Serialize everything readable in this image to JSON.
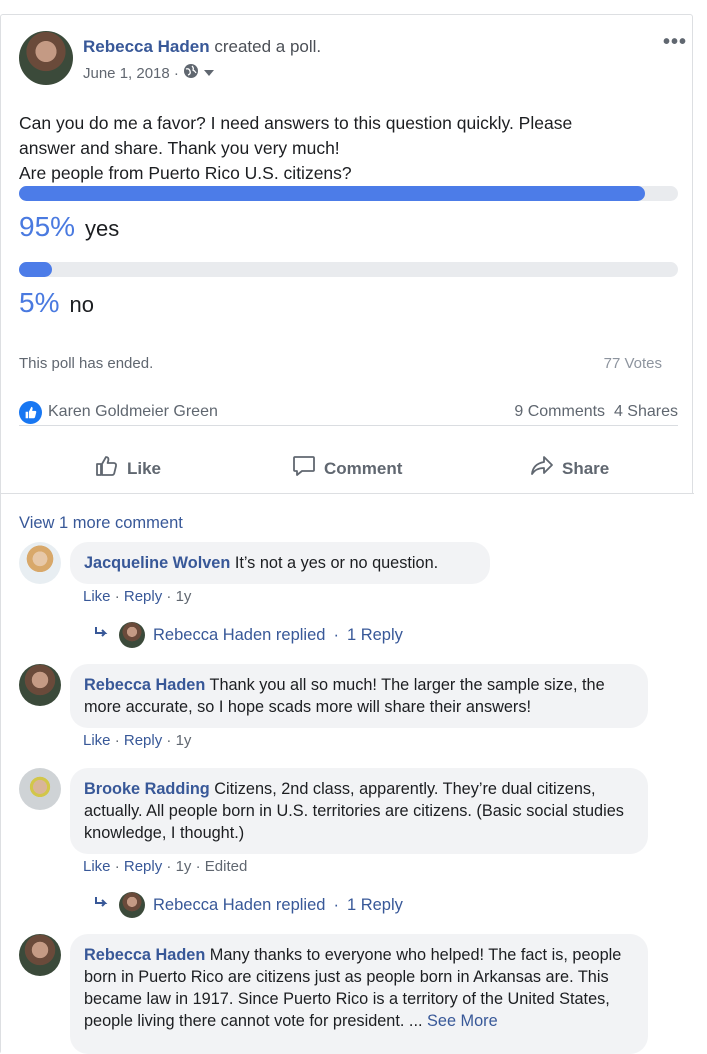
{
  "post": {
    "author": "Rebecca Haden",
    "action": "created a poll.",
    "date": "June 1, 2018 ·",
    "privacy_icon": "globe-icon",
    "more_label": "•••",
    "text_line1": "Can you do me a favor? I need answers to this question quickly. Please",
    "text_line2": "answer and share. Thank you very much!",
    "text_line3": "Are people from Puerto Rico U.S. citizens?"
  },
  "poll": {
    "options": [
      {
        "percent_label": "95%",
        "label": "yes",
        "fraction": 0.95
      },
      {
        "percent_label": "5%",
        "label": "no",
        "fraction": 0.05
      }
    ],
    "status": "This poll has ended.",
    "votes": "77 Votes"
  },
  "reactions": {
    "reactor": "Karen Goldmeier Green",
    "comments_count": "9 Comments",
    "shares_count": "4 Shares"
  },
  "actions": {
    "like": "Like",
    "comment": "Comment",
    "share": "Share"
  },
  "comments": {
    "view_more": "View 1 more comment",
    "items": [
      {
        "name": "Jacqueline Wolven",
        "text": "It’s not a yes or no question.",
        "like": "Like",
        "reply": "Reply",
        "time": "1y",
        "edited": "",
        "replied_by": "Rebecca Haden replied",
        "reply_count": "1 Reply"
      },
      {
        "name": "Rebecca Haden",
        "text": "Thank you all so much! The larger the sample size, the more accurate, so I hope scads more will share their answers!",
        "like": "Like",
        "reply": "Reply",
        "time": "1y",
        "edited": ""
      },
      {
        "name": "Brooke Radding",
        "text": "Citizens, 2nd class, apparently. They’re dual citizens, actually. All people born in U.S. territories are citizens. (Basic social studies knowledge, I thought.)",
        "like": "Like",
        "reply": "Reply",
        "time": "1y",
        "edited": "Edited",
        "replied_by": "Rebecca Haden replied",
        "reply_count": "1 Reply"
      },
      {
        "name": "Rebecca Haden",
        "text": "Many thanks to everyone who helped! The fact is, people born in Puerto Rico are citizens just as people born in Arkansas are. This became law in 1917. Since Puerto Rico is a territory of the United States, people living there cannot vote for president. ...",
        "see_more": "See More"
      }
    ]
  },
  "colors": {
    "link": "#385898",
    "poll_fill": "#4c7ce8",
    "like_badge": "#1877f2"
  }
}
